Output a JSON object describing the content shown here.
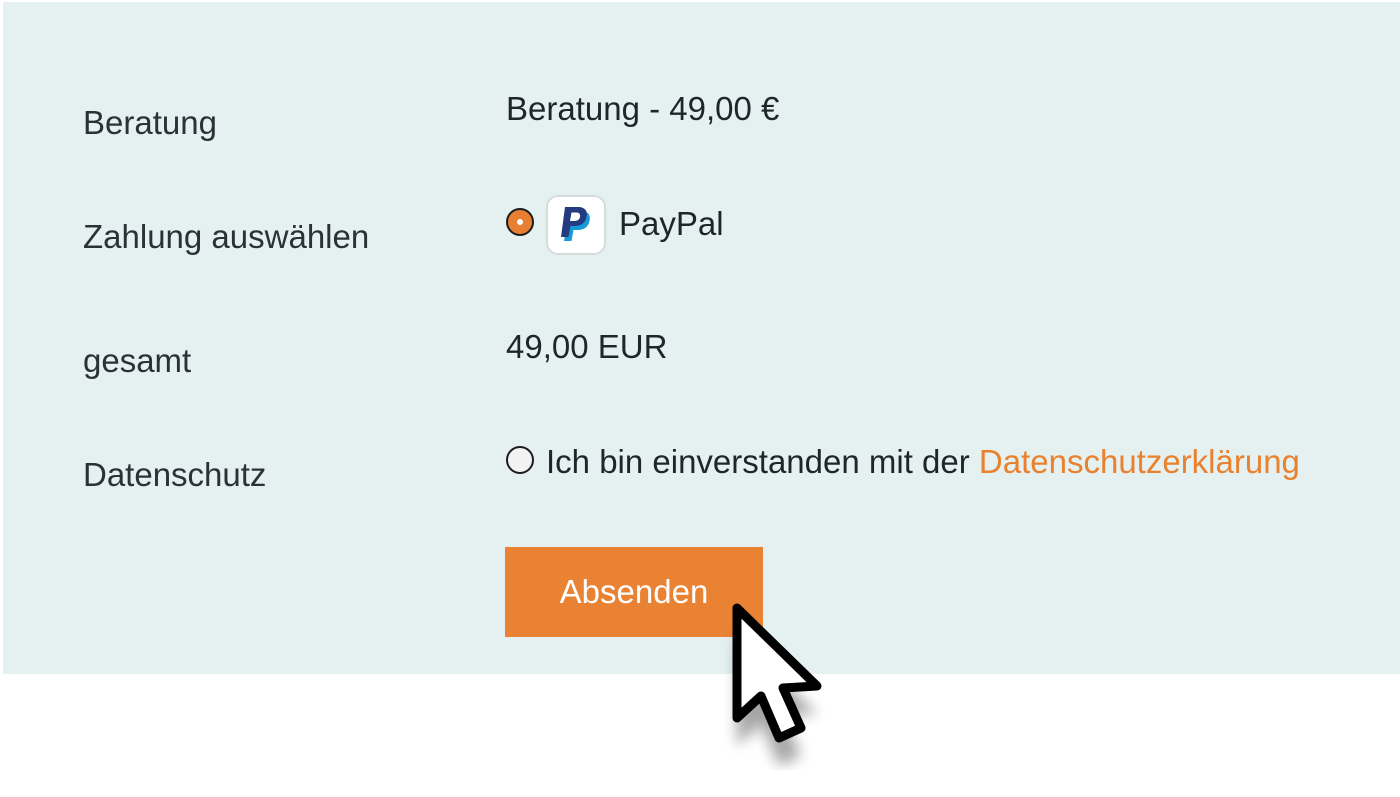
{
  "form": {
    "rows": [
      {
        "label": "Beratung",
        "value": "Beratung - 49,00 €"
      },
      {
        "label": "Zahlung auswählen",
        "option": "PayPal"
      },
      {
        "label": "gesamt",
        "value": "49,00 EUR"
      },
      {
        "label": "Datenschutz",
        "consent_text": "Ich bin einverstanden mit der ",
        "consent_link": "Datenschutzerklärung"
      }
    ],
    "submit_label": "Absenden"
  },
  "colors": {
    "panel_background": "#e5f0f0",
    "accent": "#ea8233",
    "paypal_dark": "#253b80",
    "paypal_light": "#179bd7"
  },
  "icons": {
    "payment": "paypal-logo-icon",
    "pointer": "mouse-pointer-icon"
  }
}
